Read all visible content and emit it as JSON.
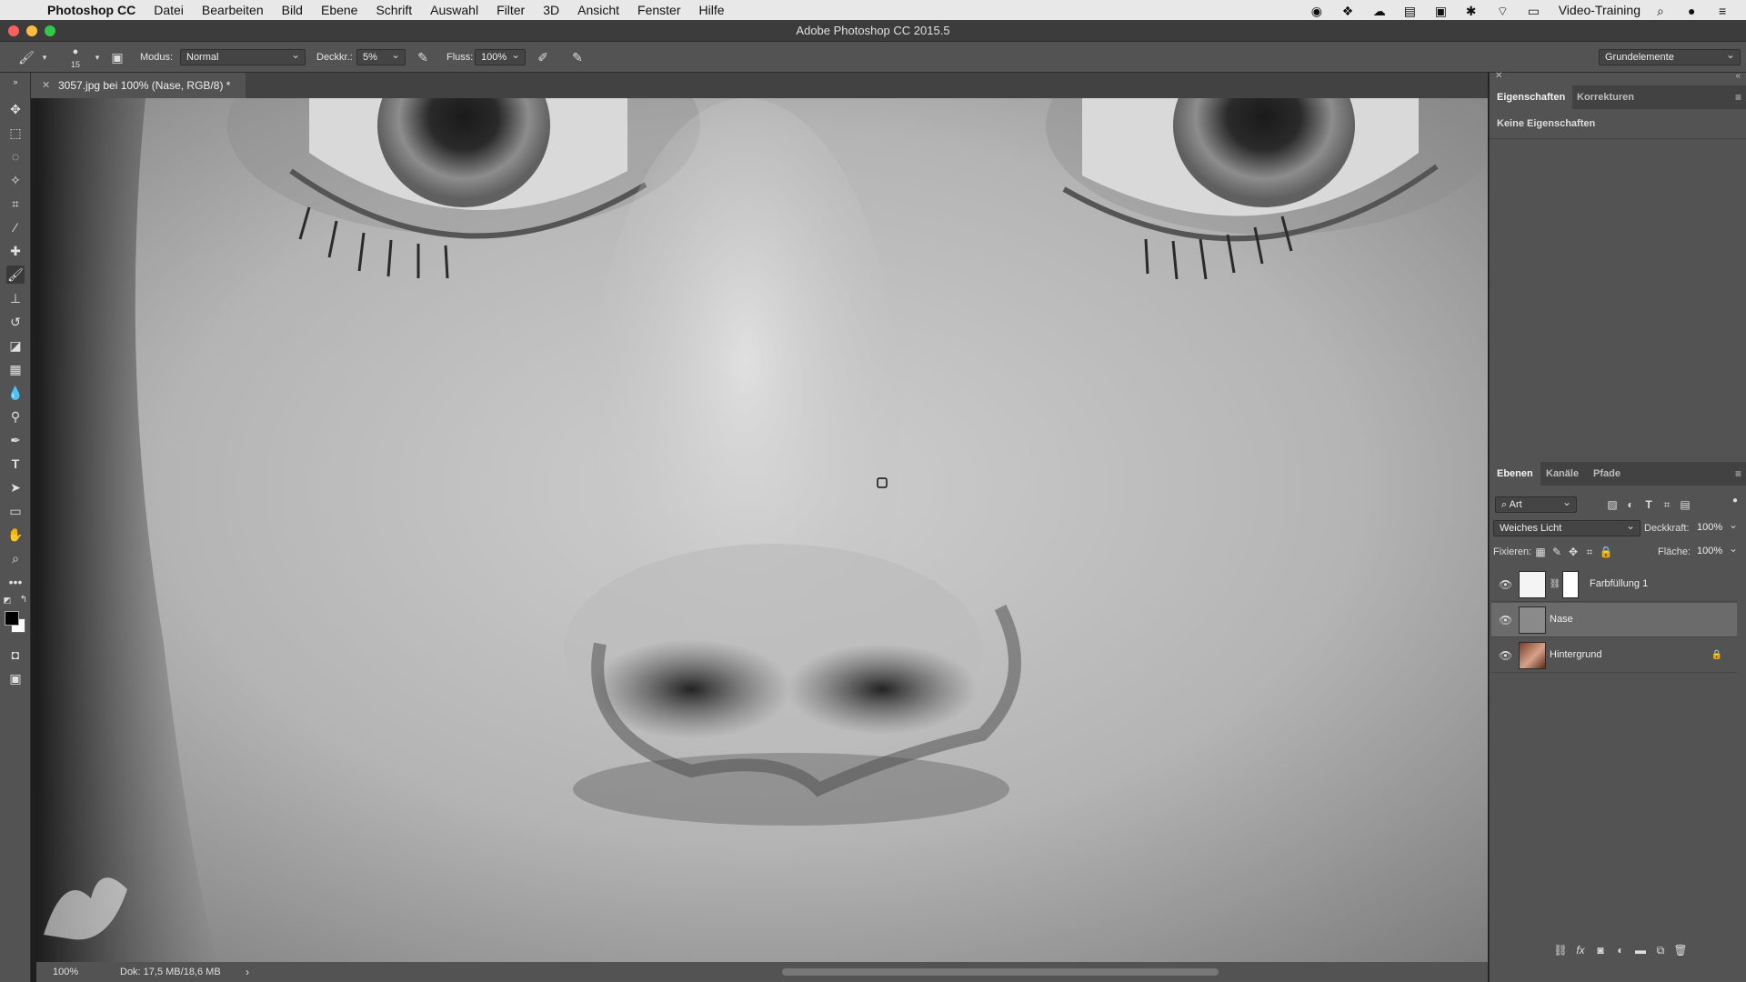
{
  "menubar": {
    "app_name": "Photoshop CC",
    "items": [
      "Datei",
      "Bearbeiten",
      "Bild",
      "Ebene",
      "Schrift",
      "Auswahl",
      "Filter",
      "3D",
      "Ansicht",
      "Fenster",
      "Hilfe"
    ],
    "user_label": "Video-Training"
  },
  "window": {
    "title": "Adobe Photoshop CC 2015.5"
  },
  "options": {
    "brush_size": "15",
    "modus_label": "Modus:",
    "modus_value": "Normal",
    "deckkraft_label": "Deckkr.:",
    "deckkraft_value": "5%",
    "fluss_label": "Fluss:",
    "fluss_value": "100%",
    "workspace": "Grundelemente"
  },
  "document": {
    "tab_label": "3057.jpg bei 100% (Nase, RGB/8) *",
    "zoom": "100%",
    "doc_size": "Dok: 17,5 MB/18,6 MB"
  },
  "properties_panel": {
    "tabs": [
      "Eigenschaften",
      "Korrekturen"
    ],
    "active_tab": "Eigenschaften",
    "empty_text": "Keine Eigenschaften"
  },
  "layers_panel": {
    "tabs": [
      "Ebenen",
      "Kanäle",
      "Pfade"
    ],
    "filter_label": "Art",
    "blend_mode": "Weiches Licht",
    "deckkraft_label": "Deckkraft:",
    "deckkraft_value": "100%",
    "fixieren_label": "Fixieren:",
    "flaeche_label": "Fläche:",
    "flaeche_value": "100%",
    "layers": [
      {
        "name": "Farbfüllung 1",
        "visible": true,
        "selected": false,
        "locked": false
      },
      {
        "name": "Nase",
        "visible": true,
        "selected": true,
        "locked": false
      },
      {
        "name": "Hintergrund",
        "visible": true,
        "selected": false,
        "locked": true
      }
    ]
  },
  "colors": {
    "accent_selected_layer": "#6b6b6b",
    "panel_bg": "#535353",
    "foreground_swatch": "#000000",
    "background_swatch": "#ffffff"
  }
}
